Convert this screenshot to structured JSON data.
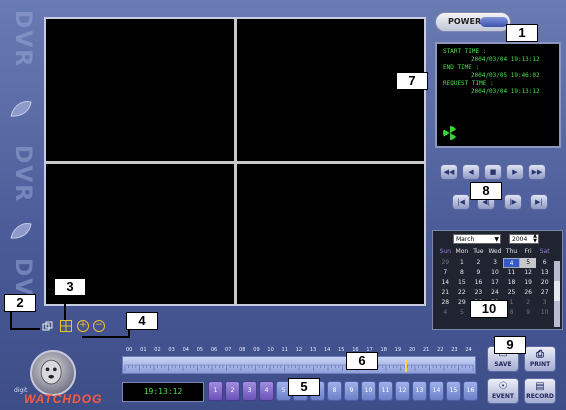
{
  "left_strip": {
    "watermark": "DVR"
  },
  "power": {
    "label": "POWER"
  },
  "info": {
    "start_label": "START TIME :",
    "start_value": "2004/03/04 19:13:12",
    "end_label": "END TIME :",
    "end_value": "2004/03/05 19:46:02",
    "request_label": "REQUEST TIME :",
    "request_value": "2004/03/04 19:13:12"
  },
  "playback": {
    "row1": [
      {
        "name": "rewind-fast-button",
        "icon": "fast-rewind-icon",
        "glyph": "◀◀"
      },
      {
        "name": "rewind-button",
        "icon": "rewind-icon",
        "glyph": "◀"
      },
      {
        "name": "stop-button",
        "icon": "stop-icon",
        "glyph": "■"
      },
      {
        "name": "play-button",
        "icon": "play-icon",
        "glyph": "▶"
      },
      {
        "name": "fast-forward-button",
        "icon": "fast-forward-icon",
        "glyph": "▶▶"
      }
    ],
    "row2": [
      {
        "name": "skip-back-button",
        "icon": "skip-back-icon",
        "glyph": "|◀"
      },
      {
        "name": "step-back-button",
        "icon": "step-back-icon",
        "glyph": "◀|"
      },
      {
        "name": "step-forward-button",
        "icon": "step-forward-icon",
        "glyph": "|▶"
      },
      {
        "name": "skip-forward-button",
        "icon": "skip-forward-icon",
        "glyph": "▶|"
      }
    ]
  },
  "calendar": {
    "month": "March",
    "year": "2004",
    "weekdays": [
      "Sun",
      "Mon",
      "Tue",
      "Wed",
      "Thu",
      "Fri",
      "Sat"
    ],
    "days": [
      {
        "d": "29",
        "dim": true
      },
      {
        "d": "1"
      },
      {
        "d": "2"
      },
      {
        "d": "3"
      },
      {
        "d": "4",
        "selected": true
      },
      {
        "d": "5",
        "current": true
      },
      {
        "d": "6"
      },
      {
        "d": "7"
      },
      {
        "d": "8"
      },
      {
        "d": "9"
      },
      {
        "d": "10"
      },
      {
        "d": "11"
      },
      {
        "d": "12"
      },
      {
        "d": "13"
      },
      {
        "d": "14"
      },
      {
        "d": "15"
      },
      {
        "d": "16"
      },
      {
        "d": "17"
      },
      {
        "d": "18"
      },
      {
        "d": "19"
      },
      {
        "d": "20"
      },
      {
        "d": "21"
      },
      {
        "d": "22"
      },
      {
        "d": "23"
      },
      {
        "d": "24"
      },
      {
        "d": "25"
      },
      {
        "d": "26"
      },
      {
        "d": "27"
      },
      {
        "d": "28"
      },
      {
        "d": "29"
      },
      {
        "d": "30"
      },
      {
        "d": "31"
      },
      {
        "d": "1",
        "dim": true
      },
      {
        "d": "2",
        "dim": true
      },
      {
        "d": "3",
        "dim": true
      },
      {
        "d": "4",
        "dim": true
      },
      {
        "d": "5",
        "dim": true
      },
      {
        "d": "6",
        "dim": true
      },
      {
        "d": "7",
        "dim": true
      },
      {
        "d": "8",
        "dim": true
      },
      {
        "d": "9",
        "dim": true
      },
      {
        "d": "10",
        "dim": true
      }
    ]
  },
  "timeline": {
    "hours": [
      "00",
      "01",
      "02",
      "03",
      "04",
      "05",
      "06",
      "07",
      "08",
      "09",
      "10",
      "11",
      "12",
      "13",
      "14",
      "15",
      "16",
      "17",
      "18",
      "19",
      "20",
      "21",
      "22",
      "23",
      "24"
    ]
  },
  "clock": "19:13:12",
  "channels": [
    {
      "label": "1",
      "on": true
    },
    {
      "label": "2",
      "on": true
    },
    {
      "label": "3",
      "on": true
    },
    {
      "label": "4",
      "on": true
    },
    {
      "label": "5",
      "on": false
    },
    {
      "label": "6",
      "on": false
    },
    {
      "label": "7",
      "on": false
    },
    {
      "label": "8",
      "on": false
    },
    {
      "label": "9",
      "on": false
    },
    {
      "label": "10",
      "on": false
    },
    {
      "label": "11",
      "on": false
    },
    {
      "label": "12",
      "on": false
    },
    {
      "label": "13",
      "on": false
    },
    {
      "label": "14",
      "on": false
    },
    {
      "label": "15",
      "on": false
    },
    {
      "label": "16",
      "on": false
    }
  ],
  "actions": {
    "save": "SAVE",
    "print": "PRINT",
    "event": "EVENT",
    "record": "RECORD"
  },
  "brand": {
    "logo": "WATCHDOG",
    "small": "digit"
  },
  "callouts": [
    "1",
    "2",
    "3",
    "4",
    "5",
    "6",
    "7",
    "8",
    "9",
    "10"
  ],
  "colors": {
    "accent_green": "#4ee04e",
    "background": "#495a97",
    "channel_active": "#8a72d0"
  }
}
